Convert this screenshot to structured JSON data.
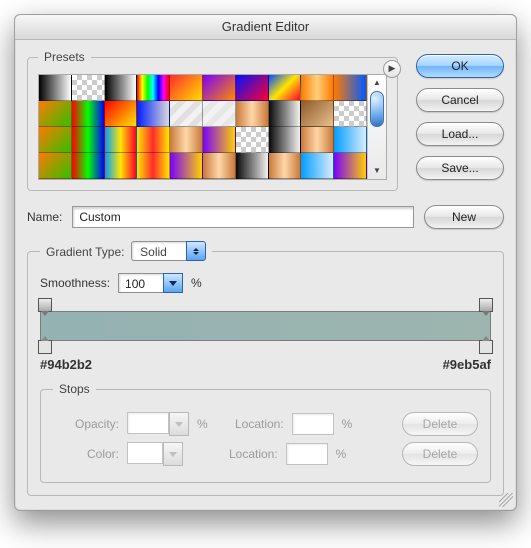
{
  "title": "Gradient Editor",
  "buttons": {
    "ok": "OK",
    "cancel": "Cancel",
    "load": "Load...",
    "save": "Save...",
    "new": "New",
    "delete": "Delete"
  },
  "presets_label": "Presets",
  "name_label": "Name:",
  "name_value": "Custom",
  "gt_label": "Gradient Type:",
  "gt_value": "Solid",
  "smooth_label": "Smoothness:",
  "smooth_value": "100",
  "pct": "%",
  "hex_left": "#94b2b2",
  "hex_right": "#9eb5af",
  "stops_label": "Stops",
  "opacity_label": "Opacity:",
  "color_label": "Color:",
  "location_label": "Location:",
  "swatches": [
    "linear-gradient(to right,#000,#fff)",
    "repeating-conic-gradient(#ccc 0 25%,#fff 0 50%) 0 0/10px 10px",
    "linear-gradient(to right,#000,#fff)",
    "linear-gradient(to right,#ff0000,#ffff00,#00ff00,#00ffff,#0000ff,#ff00ff,#ff0000)",
    "linear-gradient(135deg,#ff2d2d,#ffdd00)",
    "linear-gradient(135deg,#7a00ff,#ff8a00)",
    "linear-gradient(135deg,#0011ff,#ff0033)",
    "linear-gradient(135deg,#004dff,#ffe600,#ff0033)",
    "linear-gradient(to right,#ff7a00,#ffd07a,#ff7a00)",
    "linear-gradient(to right,#ff7a00,#005bff)",
    "linear-gradient(135deg,#ff7a00,#30c000)",
    "linear-gradient(to right,#ff0000,#00ff00,#0000ff)",
    "linear-gradient(135deg,#ff0000,#ffe600)",
    "linear-gradient(to right,#001dff,#d9d9d9)",
    "repeating-linear-gradient(135deg,#f2f2f2 0 6px,#e0e0e0 6px 12px)",
    "repeating-linear-gradient(135deg,#f2f2f2 0 6px,#e7e7e7 6px 12px)",
    "linear-gradient(to right,#c97a3b,#ffd7a8,#c97a3b)",
    "linear-gradient(to right,#0a0a0a,#f2f2f2)",
    "linear-gradient(135deg,#8d5a2b,#e9c08c)",
    "repeating-conic-gradient(#ccc 0 25%,#fff 0 50%) 0 0/10px 10px",
    "linear-gradient(135deg,#ff7a00,#30c000)",
    "linear-gradient(to right,#ff0000,#00ff00,#0000ff)",
    "linear-gradient(to right,#009dff,#ffe600,#ff002b)",
    "linear-gradient(to right,#ffe600,#ff2b2b,#ffe600)",
    "linear-gradient(to right,#c97a3b,#ffd7a8,#c97a3b)",
    "linear-gradient(to right,#7a00ff,#ffd000)",
    "repeating-conic-gradient(#ccc 0 25%,#fff 0 50%) 0 0/10px 10px",
    "linear-gradient(to right,#0a0a0a,#f2f2f2)",
    "linear-gradient(to right,#c97a3b,#ffd7a8,#c97a3b)",
    "linear-gradient(to right,#009dff,#d9ecff)",
    "linear-gradient(135deg,#ff7a00,#30c000)",
    "linear-gradient(to right,#ff0000,#00ff00,#0000ff)",
    "linear-gradient(to right,#009dff,#ffe600,#ff002b)",
    "linear-gradient(to right,#ffe600,#ff2b2b,#ffe600)",
    "linear-gradient(to right,#7a00ff,#ffd000)",
    "linear-gradient(to right,#c97a3b,#ffd7a8,#c97a3b)",
    "linear-gradient(to right,#0a0a0a,#f2f2f2)",
    "linear-gradient(to right,#c97a3b,#ffd7a8,#c97a3b)",
    "linear-gradient(to right,#009dff,#d9ecff)",
    "linear-gradient(to right,#7a00ff,#ffd000)"
  ]
}
